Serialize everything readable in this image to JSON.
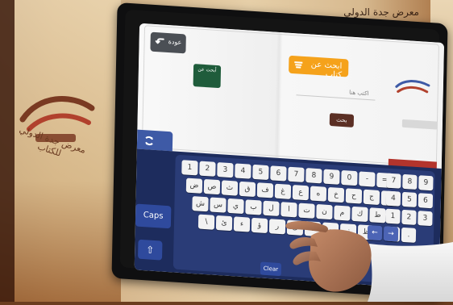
{
  "scene": {
    "top_title": "معرض جدة الدولي",
    "left_caption": "معرض جدة الدولي للكتاب"
  },
  "screen": {
    "back_label": "عودة",
    "green_thumb_label": "أبحث عن",
    "search_tab_label": "ابحث عن كتاب",
    "search_placeholder": "اكتب هنا",
    "go_button_label": "بحث"
  },
  "keyboard": {
    "caps_label": "Caps",
    "shift_label": "⇧",
    "clear_label": "Clear",
    "row1": [
      "1",
      "2",
      "3",
      "4",
      "5",
      "6",
      "7",
      "8",
      "9",
      "0",
      "-",
      "="
    ],
    "row2": [
      "ض",
      "ص",
      "ث",
      "ق",
      "ف",
      "غ",
      "ع",
      "ه",
      "خ",
      "ح",
      "ج",
      "د"
    ],
    "row3": [
      "ش",
      "س",
      "ي",
      "ب",
      "ل",
      "ا",
      "ت",
      "ن",
      "م",
      "ك",
      "ط"
    ],
    "row4": [
      "\\",
      "ئ",
      "ء",
      "ؤ",
      "ر",
      "ى",
      "ة",
      "و",
      "ز",
      "ظ"
    ],
    "numpad": [
      "7",
      "8",
      "9",
      "4",
      "5",
      "6",
      "1",
      "2",
      "3",
      "0",
      "."
    ]
  },
  "colors": {
    "keyboard_bg": "#1d2c5d",
    "keyboard_panel": "#2a3c77",
    "accent_orange": "#f5a21b",
    "accent_green": "#1f5c3b",
    "accent_brown": "#5b2f24"
  }
}
